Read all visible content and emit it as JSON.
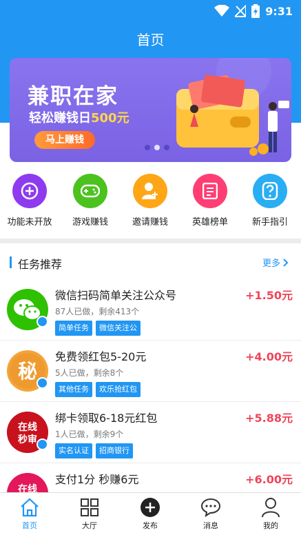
{
  "status": {
    "time": "9:31"
  },
  "header": {
    "title": "首页"
  },
  "banner": {
    "title": "兼职在家",
    "subtitle_prefix": "轻松赚钱日",
    "subtitle_highlight": "500元",
    "button": "马上赚钱"
  },
  "menu": [
    {
      "label": "功能未开放",
      "icon": "plus-icon",
      "color": "#8e3bf0"
    },
    {
      "label": "游戏赚钱",
      "icon": "gamepad-icon",
      "color": "#4cc21f"
    },
    {
      "label": "邀请赚钱",
      "icon": "add-user-icon",
      "color": "#ffa618"
    },
    {
      "label": "英雄榜单",
      "icon": "list-icon",
      "color": "#ff3e74"
    },
    {
      "label": "新手指引",
      "icon": "question-icon",
      "color": "#29aef3"
    }
  ],
  "section": {
    "title": "任务推荐",
    "more": "更多"
  },
  "tasks": [
    {
      "title": "微信扫码简单关注公众号",
      "price": "+1.50元",
      "meta": "87人已做，剩余413个",
      "tags": [
        "简单任务",
        "微信关注公"
      ]
    },
    {
      "title": "免费领红包5-20元",
      "price": "+4.00元",
      "meta": "5人已做，剩余8个",
      "tags": [
        "其他任务",
        "欢乐抢红包"
      ],
      "avatar_text": "秘"
    },
    {
      "title": "绑卡领取6-18元红包",
      "price": "+5.88元",
      "meta": "1人已做，剩余9个",
      "tags": [
        "实名认证",
        "招商银行"
      ],
      "avatar_text": "在线\n秒审"
    },
    {
      "title": "支付1分 秒赚6元",
      "price": "+6.00元",
      "meta": "",
      "tags": [],
      "avatar_text": "在线"
    }
  ],
  "tabbar": [
    {
      "label": "首页",
      "icon": "home-icon",
      "active": true
    },
    {
      "label": "大厅",
      "icon": "grid-icon"
    },
    {
      "label": "发布",
      "icon": "publish-plus-icon"
    },
    {
      "label": "消息",
      "icon": "chat-icon"
    },
    {
      "label": "我的",
      "icon": "user-icon"
    }
  ],
  "colors": {
    "primary": "#2196f3",
    "price": "#f0455a",
    "banner": "#7a62e4"
  }
}
